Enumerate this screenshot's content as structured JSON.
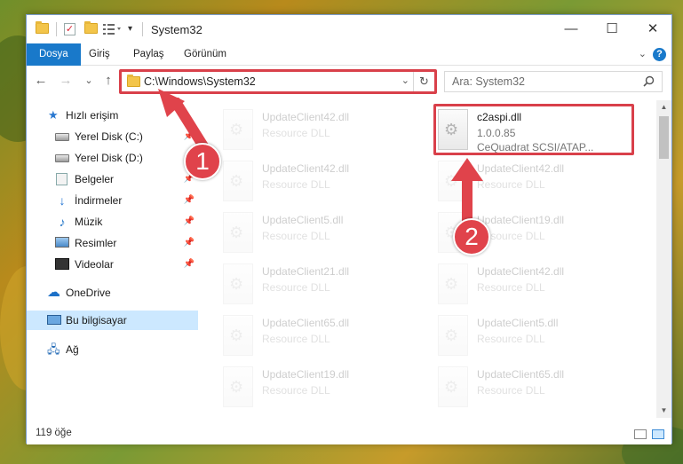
{
  "window": {
    "title": "System32",
    "minimize": "—",
    "maximize": "☐",
    "close": "✕"
  },
  "ribbon": {
    "tabs": [
      {
        "label": "Dosya"
      },
      {
        "label": "Giriş"
      },
      {
        "label": "Paylaş"
      },
      {
        "label": "Görünüm"
      }
    ],
    "help": "?"
  },
  "nav": {
    "back": "←",
    "forward": "→",
    "recent": "⌄",
    "up": "↑",
    "address": "C:\\Windows\\System32",
    "refresh": "↻",
    "search_placeholder": "Ara: System32"
  },
  "sidebar": {
    "items": [
      {
        "label": "Hızlı erişim",
        "icon": "star-icon"
      },
      {
        "label": "Yerel Disk (C:)",
        "icon": "disk-icon"
      },
      {
        "label": "Yerel Disk (D:)",
        "icon": "disk-icon"
      },
      {
        "label": "Belgeler",
        "icon": "documents-icon"
      },
      {
        "label": "İndirmeler",
        "icon": "download-icon"
      },
      {
        "label": "Müzik",
        "icon": "music-icon"
      },
      {
        "label": "Resimler",
        "icon": "pictures-icon"
      },
      {
        "label": "Videolar",
        "icon": "videos-icon"
      },
      {
        "label": "OneDrive",
        "icon": "cloud-icon"
      },
      {
        "label": "Bu bilgisayar",
        "icon": "computer-icon"
      },
      {
        "label": "Ağ",
        "icon": "network-icon"
      }
    ]
  },
  "files": {
    "left": [
      {
        "name": "UpdateClient42.dll",
        "desc": "Resource DLL"
      },
      {
        "name": "UpdateClient42.dll",
        "desc": "Resource DLL"
      },
      {
        "name": "UpdateClient5.dll",
        "desc": "Resource DLL"
      },
      {
        "name": "UpdateClient21.dll",
        "desc": "Resource DLL"
      },
      {
        "name": "UpdateClient65.dll",
        "desc": "Resource DLL"
      },
      {
        "name": "UpdateClient19.dll",
        "desc": "Resource DLL"
      }
    ],
    "right": [
      {
        "name": "c2aspi.dll",
        "desc": "1.0.0.85",
        "desc2": "CeQuadrat SCSI/ATAP..."
      },
      {
        "name": "UpdateClient42.dll",
        "desc": "Resource DLL"
      },
      {
        "name": "UpdateClient19.dll",
        "desc": "Resource DLL"
      },
      {
        "name": "UpdateClient42.dll",
        "desc": "Resource DLL"
      },
      {
        "name": "UpdateClient5.dll",
        "desc": "Resource DLL"
      },
      {
        "name": "UpdateClient65.dll",
        "desc": "Resource DLL"
      }
    ]
  },
  "status": {
    "count": "119 öğe"
  },
  "callouts": {
    "one": "1",
    "two": "2",
    "color": "#e0434b"
  }
}
